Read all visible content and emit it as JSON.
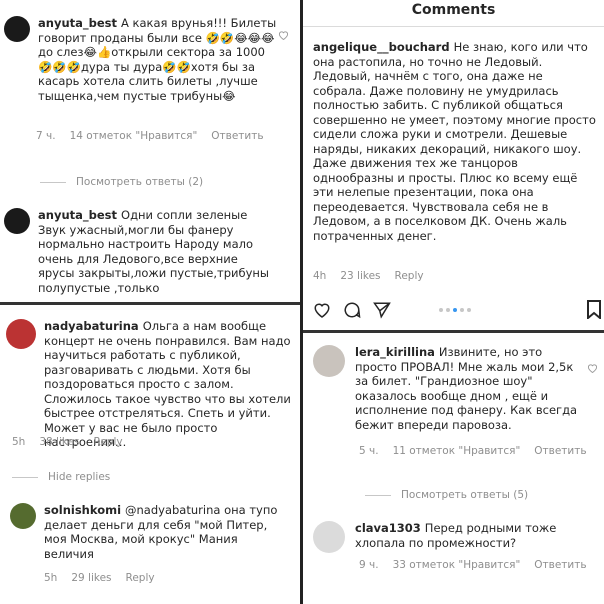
{
  "header": {
    "title": "Comments"
  },
  "left": {
    "c1": {
      "username": "anyuta_best",
      "text": "А какая врунья!!! Билеты говорит проданы были все 🤣🤣😂😂😂до слез😂👍открыли сектора за 1000🤣🤣🤣дура ты дура🤣🤣хотя бы за касарь хотела слить билеты ,лучше тыщенка,чем пустые трибуны😂",
      "time": "7 ч.",
      "likes": "14 отметок \"Нравится\"",
      "reply": "Ответить",
      "view_replies": "Посмотреть ответы (2)"
    },
    "c2": {
      "username": "anyuta_best",
      "text": "Одни сопли зеленые Звук ужасный,могли бы фанеру нормально настроить Народу мало очень для Ледового,все верхние ярусы закрыты,ложи пустые,трибуны полупустые ,только"
    },
    "c3": {
      "username": "nadyabaturina",
      "text": "Ольга а нам вообще концерт не очень понравился. Вам надо научиться работать с публикой, разговаривать с людьми. Хотя бы поздороваться просто с залом. Сложилось такое чувство что вы хотели быстрее отстреляться. Спеть и уйти. Может у вас не было просто настроения…",
      "time": "5h",
      "likes": "38 likes",
      "reply": "Reply",
      "hide_replies": "Hide replies"
    },
    "c4": {
      "username": "solnishkomi",
      "text": "@nadyabaturina она тупо делает деньги для себя \"мой Питер, моя Москва, мой крокус\" Мания величия",
      "time": "5h",
      "likes": "29 likes",
      "reply": "Reply"
    }
  },
  "right": {
    "c1": {
      "username": "angelique__bouchard",
      "text": "Не знаю, кого или что она растопила, но точно не Ледовый. Ледовый, начнём с того, она даже не собрала. Даже половину не умудрилась полностью забить. С публикой общаться совершенно не умеет, поэтому многие просто сидели сложа руки и смотрели. Дешевые наряды, никаких декораций, никакого шоу. Даже движения тех же танцоров однообразны и просты. Плюс ко всему ещё эти нелепые презентации, пока она переодевается. Чувствовала себя не в Ледовом, а в поселковом ДК. Очень жаль потраченных денег.",
      "time": "4h",
      "likes": "23 likes",
      "reply": "Reply"
    },
    "c2": {
      "username": "lera_kirillina",
      "text": "Извините, но это просто ПРОВАЛ! Мне жаль мои 2,5к за билет. \"Грандиозное шоу\" оказалось вообще дном , ещё и исполнение под фанеру. Как всегда бежит впереди паровоза.",
      "time": "5 ч.",
      "likes": "11 отметок \"Нравится\"",
      "reply": "Ответить",
      "view_replies": "Посмотреть ответы (5)"
    },
    "c3": {
      "username": "clava1303",
      "text": "Перед родными тоже хлопала по промежности?",
      "time": "9 ч.",
      "likes": "33 отметок \"Нравится\"",
      "reply": "Ответить"
    }
  },
  "colors": {
    "text": "#262626",
    "meta": "#8e8e8e",
    "dot_active": "#3897f0",
    "dot": "#c7c7c7"
  },
  "icons": [
    "heart-icon",
    "comment-icon",
    "share-icon",
    "bookmark-icon"
  ]
}
